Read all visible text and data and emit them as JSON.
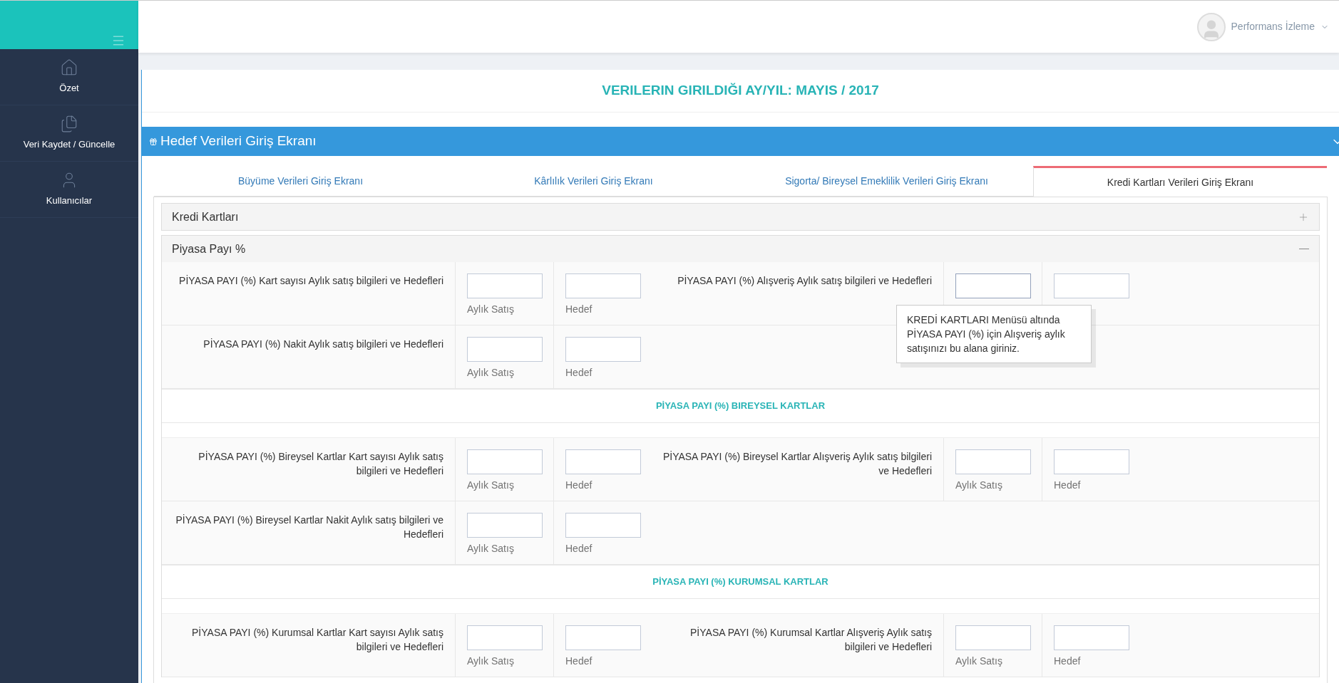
{
  "sidebar": {
    "items": [
      {
        "label": "Özet",
        "kind": "home"
      },
      {
        "label": "Veri Kaydet / Güncelle",
        "kind": "files"
      },
      {
        "label": "Kullanıcılar",
        "kind": "user"
      }
    ]
  },
  "header": {
    "user": "Performans İzleme"
  },
  "page_title": "VERILERIN GIRILDIĞI AY/YIL: MAYIS / 2017",
  "panel": {
    "title": "Hedef Verileri Giriş Ekranı"
  },
  "tabs": [
    {
      "label": "Büyüme Verileri Giriş Ekranı",
      "selected": false
    },
    {
      "label": "Kârlılık Verileri Giriş Ekranı",
      "selected": false
    },
    {
      "label": "Sigorta/ Bireysel Emeklilik Verileri Giriş Ekranı",
      "selected": false
    },
    {
      "label": "Kredi Kartları Verileri Giriş Ekranı",
      "selected": true
    }
  ],
  "accordions": [
    {
      "title": "Kredi Kartları",
      "expanded": false
    },
    {
      "title": "Piyasa Payı %",
      "expanded": true
    }
  ],
  "groups": [
    {
      "rows": [
        {
          "items": [
            {
              "label": "PİYASA PAYI (%) Kart sayısı Aylık satış bilgileri ve Hedefleri",
              "fields": [
                {
                  "caption": "Aylık Satış",
                  "focused": false
                },
                {
                  "caption": "Hedef",
                  "focused": false
                }
              ]
            },
            {
              "label": "PİYASA PAYI (%) Alışveriş Aylık satış bilgileri ve Hedefleri",
              "fields": [
                {
                  "tooltip": "KREDİ KARTLARI Menüsü altında PİYASA PAYI (%) için Alışveriş aylık satışınızı bu alana giriniz.",
                  "focused": true
                },
                {
                  "focused": false
                }
              ]
            }
          ]
        },
        {
          "items": [
            {
              "label": "PİYASA PAYI (%) Nakit Aylık satış bilgileri ve Hedefleri",
              "fields": [
                {
                  "caption": "Aylık Satış",
                  "focused": false
                },
                {
                  "caption": "Hedef",
                  "focused": false
                }
              ]
            }
          ]
        }
      ]
    },
    {
      "heading": "PİYASA PAYI (%) BIREYSEL KARTLAR",
      "rows": [
        {
          "items": [
            {
              "label": "PİYASA PAYI (%) Bireysel Kartlar Kart sayısı Aylık satış bilgileri ve Hedefleri",
              "fields": [
                {
                  "caption": "Aylık Satış",
                  "focused": false
                },
                {
                  "caption": "Hedef",
                  "focused": false
                }
              ]
            },
            {
              "label": "PİYASA PAYI (%) Bireysel Kartlar Alışveriş Aylık satış bilgileri ve Hedefleri",
              "fields": [
                {
                  "caption": "Aylık Satış",
                  "focused": false
                },
                {
                  "caption": "Hedef",
                  "focused": false
                }
              ]
            }
          ]
        },
        {
          "items": [
            {
              "label": "PİYASA PAYI (%) Bireysel Kartlar Nakit Aylık satış bilgileri ve Hedefleri",
              "fields": [
                {
                  "caption": "Aylık Satış",
                  "focused": false
                },
                {
                  "caption": "Hedef",
                  "focused": false
                }
              ]
            }
          ]
        }
      ]
    },
    {
      "heading": "PİYASA PAYI (%) KURUMSAL KARTLAR",
      "rows": [
        {
          "items": [
            {
              "label": "PİYASA PAYI (%) Kurumsal Kartlar Kart sayısı Aylık satış bilgileri ve Hedefleri",
              "fields": [
                {
                  "caption": "Aylık Satış",
                  "focused": false
                },
                {
                  "caption": "Hedef",
                  "focused": false
                }
              ]
            },
            {
              "label": "PİYASA PAYI (%) Kurumsal Kartlar Alışveriş Aylık satış bilgileri ve Hedefleri",
              "fields": [
                {
                  "caption": "Aylık Satış",
                  "focused": false
                },
                {
                  "caption": "Hedef",
                  "focused": false
                }
              ]
            }
          ]
        }
      ]
    }
  ]
}
